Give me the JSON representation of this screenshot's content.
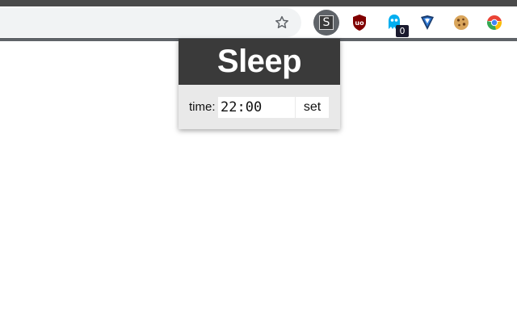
{
  "browser": {
    "extensions": [
      {
        "name": "Sleep",
        "glyph": "S"
      },
      {
        "name": "uBlock Origin",
        "glyph": "uo"
      },
      {
        "name": "Ghostery",
        "badge": "0"
      },
      {
        "name": "Shield"
      },
      {
        "name": "Cookie"
      },
      {
        "name": "Chrome Remote"
      }
    ]
  },
  "popup": {
    "title": "Sleep",
    "time_label": "time:",
    "time_value": "22:00",
    "set_label": "set"
  },
  "colors": {
    "popup_header": "#3a3a3a",
    "popup_body": "#e9e9e9",
    "ublock_red": "#800000"
  }
}
